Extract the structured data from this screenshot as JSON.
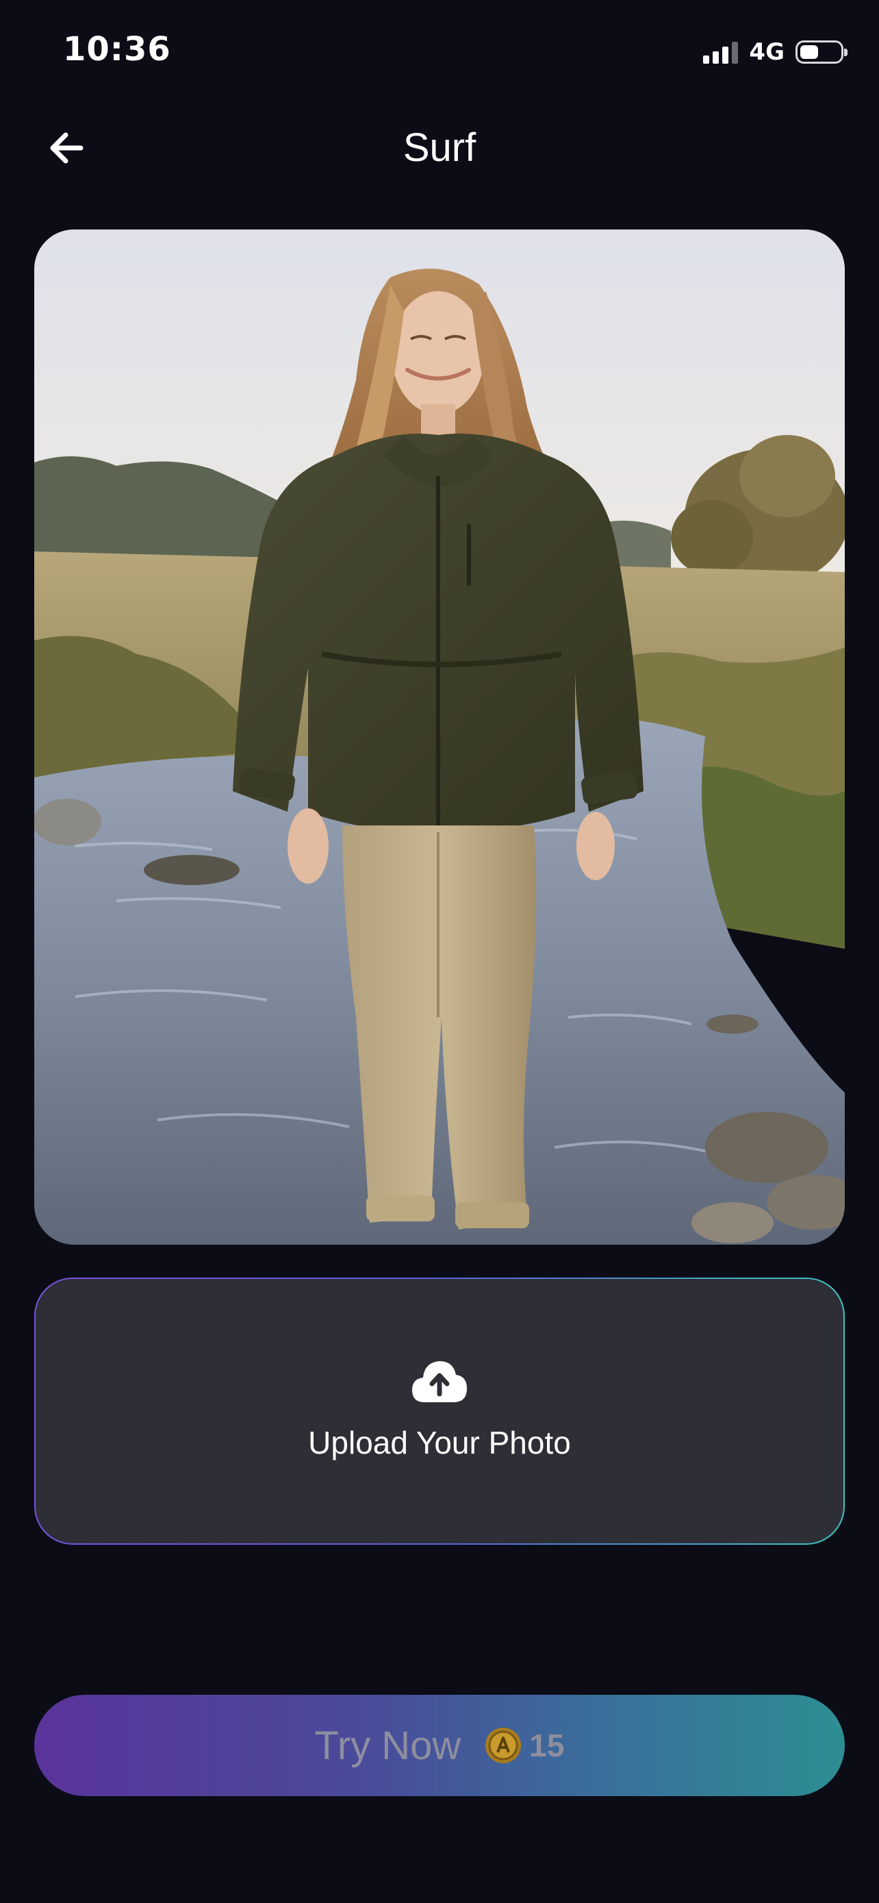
{
  "status_bar": {
    "time": "10:36",
    "network": "4G"
  },
  "header": {
    "title": "Surf",
    "back_icon": "arrow-left-icon"
  },
  "preview": {
    "image": "woman-walking-in-stream-photo"
  },
  "upload": {
    "label": "Upload Your Photo",
    "icon": "cloud-upload-icon"
  },
  "try_now": {
    "label": "Try Now",
    "coin_icon": "coin-icon",
    "cost": "15"
  },
  "colors": {
    "background": "#0b0c16",
    "card": "#2e2f36",
    "gradient_start": "#5a349b",
    "gradient_end": "#2d8e92",
    "disabled_text": "#8e8e9f"
  }
}
